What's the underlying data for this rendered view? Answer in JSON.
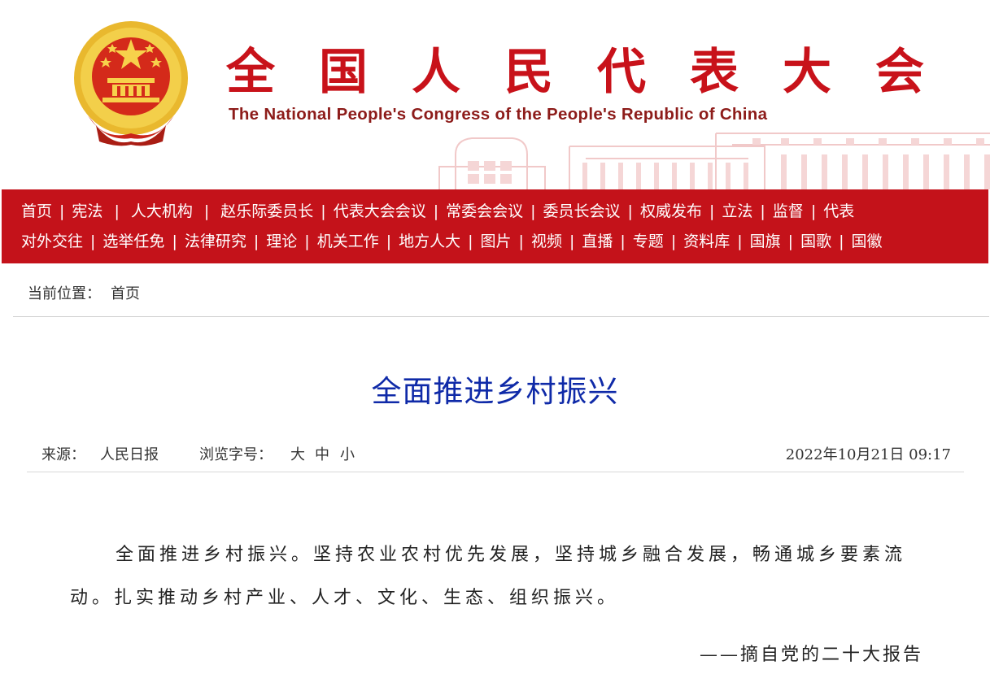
{
  "header": {
    "site_title": "全国人民代表大会",
    "site_subtitle": "The National People's Congress of the People's Republic of China"
  },
  "nav": {
    "row1": [
      "首页",
      "宪法",
      "人大机构",
      "赵乐际委员长",
      "代表大会会议",
      "常委会会议",
      "委员长会议",
      "权威发布",
      "立法",
      "监督",
      "代表"
    ],
    "row2": [
      "对外交往",
      "选举任免",
      "法律研究",
      "理论",
      "机关工作",
      "地方人大",
      "图片",
      "视频",
      "直播",
      "专题",
      "资料库",
      "国旗",
      "国歌",
      "国徽"
    ],
    "separator": "|"
  },
  "breadcrumb": {
    "label": "当前位置：",
    "current": "首页"
  },
  "article": {
    "title": "全面推进乡村振兴",
    "source_label": "来源：",
    "source": "人民日报",
    "font_size_label": "浏览字号：",
    "font_sizes": [
      "大",
      "中",
      "小"
    ],
    "datetime": "2022年10月21日  09:17",
    "body": "全面推进乡村振兴。坚持农业农村优先发展，坚持城乡融合发展，畅通城乡要素流动。扎实推动乡村产业、人才、文化、生态、组织振兴。",
    "signature": "——摘自党的二十大报告"
  },
  "colors": {
    "nav_bg": "#c4121a",
    "title_red": "#c8121a",
    "article_title_blue": "#0f2aa8"
  },
  "icons": {
    "emblem": "national-emblem-icon",
    "building": "great-hall-illustration"
  }
}
